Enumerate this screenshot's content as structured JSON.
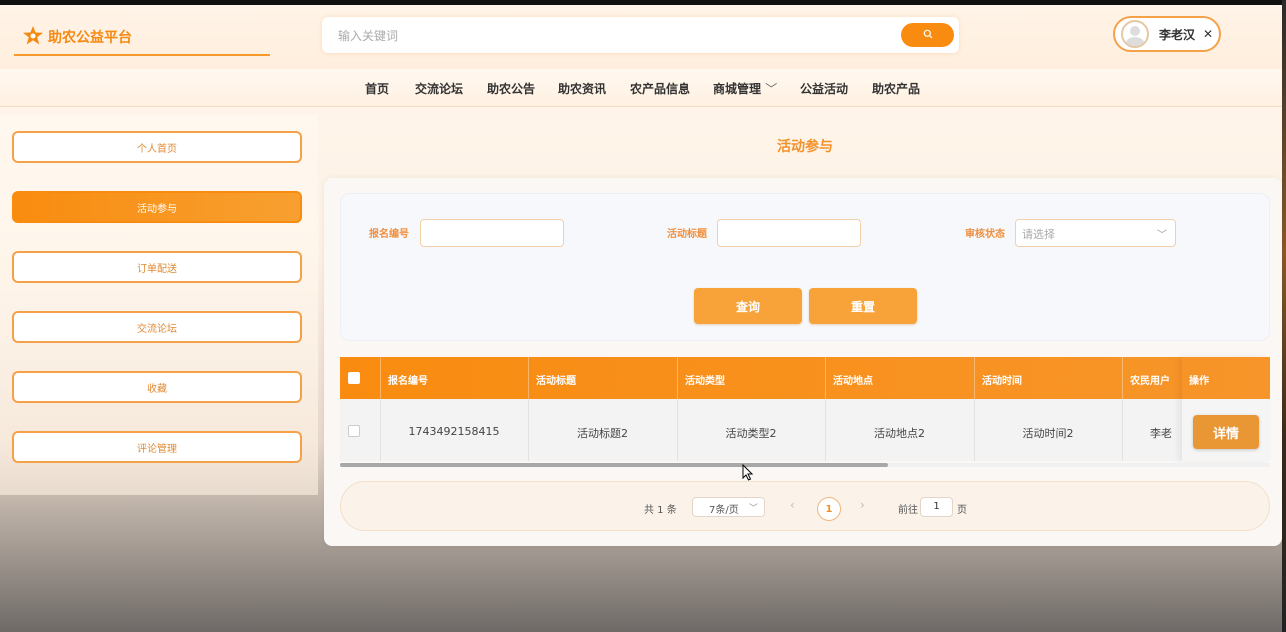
{
  "app": {
    "title": "助农公益平台"
  },
  "search": {
    "placeholder": "输入关键词"
  },
  "user": {
    "name": "李老汉"
  },
  "nav": {
    "items": [
      "首页",
      "交流论坛",
      "助农公告",
      "助农资讯",
      "农产品信息",
      "商城管理",
      "公益活动",
      "助农产品"
    ]
  },
  "sidebar": {
    "items": [
      "个人首页",
      "活动参与",
      "订单配送",
      "交流论坛",
      "收藏",
      "评论管理"
    ],
    "active": "活动参与"
  },
  "page": {
    "title": "活动参与"
  },
  "filter": {
    "signup_no_label": "报名编号",
    "activity_title_label": "活动标题",
    "review_status_label": "审核状态",
    "review_status_placeholder": "请选择",
    "query_button": "查询",
    "reset_button": "重置"
  },
  "table": {
    "headers": [
      "报名编号",
      "活动标题",
      "活动类型",
      "活动地点",
      "活动时间",
      "农民用户",
      "操作"
    ],
    "rows": [
      {
        "signup_no": "1743492158415",
        "title": "活动标题2",
        "type": "活动类型2",
        "location": "活动地点2",
        "time": "活动时间2",
        "user": "李老",
        "action": "详情"
      }
    ]
  },
  "pagination": {
    "total": "共 1 条",
    "page_size": "7条/页",
    "current": "1",
    "goto_label": "前往",
    "goto_value": "1",
    "page_unit": "页"
  },
  "colors": {
    "accent": "#f98c10",
    "accent_light": "#f7a339",
    "label": "#f09040"
  }
}
